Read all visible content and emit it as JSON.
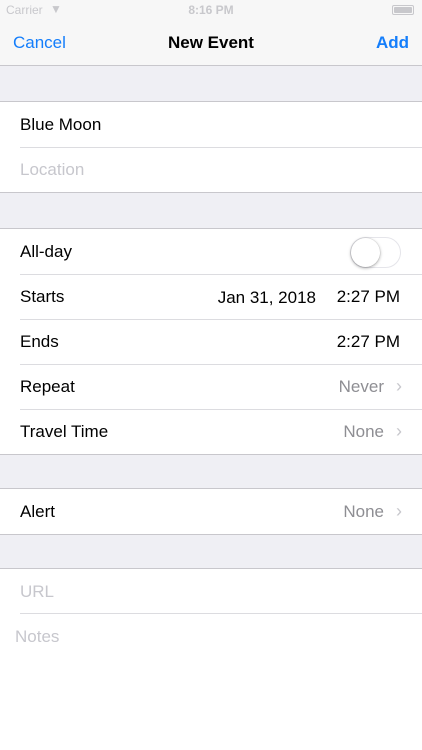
{
  "status_bar": {
    "carrier": "Carrier",
    "wifi_icon": "wifi-icon",
    "time": "8:16 PM",
    "battery_icon": "battery-icon"
  },
  "nav": {
    "cancel": "Cancel",
    "title": "New Event",
    "add": "Add",
    "accent_color": "#147efb"
  },
  "event": {
    "title_value": "Blue Moon",
    "location_placeholder": "Location"
  },
  "timing": {
    "allday_label": "All-day",
    "allday_on": false,
    "starts_label": "Starts",
    "starts_date": "Jan 31, 2018",
    "starts_time": "2:27 PM",
    "ends_label": "Ends",
    "ends_time": "2:27 PM",
    "repeat_label": "Repeat",
    "repeat_value": "Never",
    "travel_label": "Travel Time",
    "travel_value": "None"
  },
  "alert": {
    "label": "Alert",
    "value": "None"
  },
  "extras": {
    "url_placeholder": "URL",
    "notes_placeholder": "Notes"
  }
}
